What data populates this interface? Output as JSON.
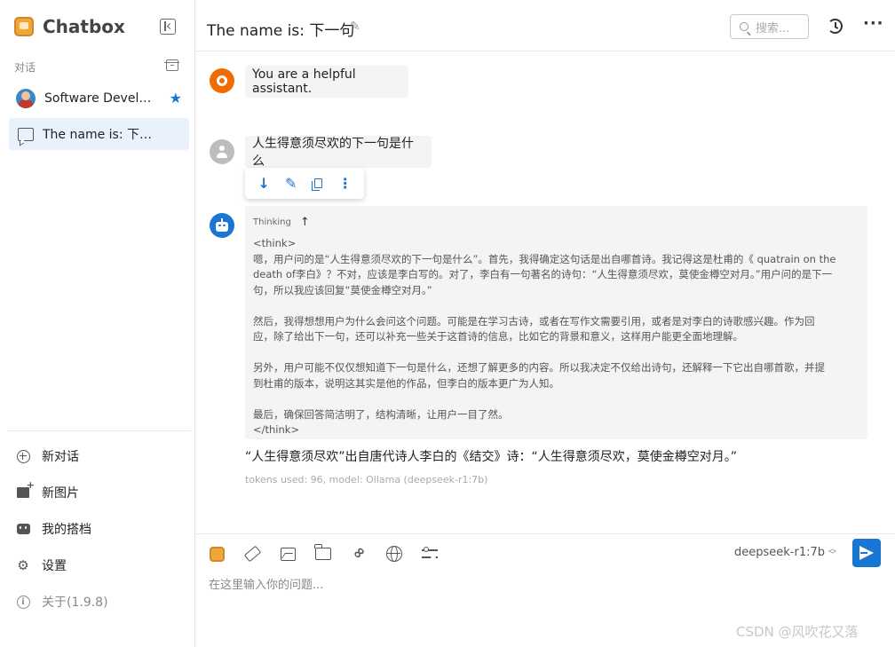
{
  "app": {
    "name": "Chatbox"
  },
  "sidebar": {
    "section_label": "对话",
    "conversations": [
      {
        "label": "Software Developer",
        "starred": true,
        "selected": false
      },
      {
        "label": "The name is: 下一句",
        "starred": false,
        "selected": true
      }
    ],
    "menu": [
      {
        "label": "新对话",
        "icon": "plus-circle-icon"
      },
      {
        "label": "新图片",
        "icon": "add-image-icon"
      },
      {
        "label": "我的搭档",
        "icon": "robot-icon"
      },
      {
        "label": "设置",
        "icon": "gear-icon"
      },
      {
        "label": "关于(1.9.8)",
        "icon": "info-icon"
      }
    ]
  },
  "header": {
    "title": "The name is: 下一句",
    "search_placeholder": "搜索..."
  },
  "messages": {
    "system": "You are a helpful assistant.",
    "user": "人生得意须尽欢的下一句是什么",
    "thinking_label": "Thinking",
    "thinking_lines": [
      "<think>",
      "嗯，用户问的是“人生得意须尽欢的下一句是什么”。首先，我得确定这句话是出自哪首诗。我记得这是杜甫的《 quatrain on the",
      "death of李白》？不对，应该是李白写的。对了，李白有一句著名的诗句：“人生得意须尽欢，莫使金樽空对月。”用户问的是下一",
      "句，所以我应该回复“莫使金樽空对月。”",
      "",
      "然后，我得想想用户为什么会问这个问题。可能是在学习古诗，或者在写作文需要引用，或者是对李白的诗歌感兴趣。作为回",
      "应，除了给出下一句，还可以补充一些关于这首诗的信息，比如它的背景和意义，这样用户能更全面地理解。",
      "",
      "另外，用户可能不仅仅想知道下一句是什么，还想了解更多的内容。所以我决定不仅给出诗句，还解释一下它出自哪首歌，并提",
      "到杜甫的版本，说明这其实是他的作品，但李白的版本更广为人知。",
      "",
      "最后，确保回答简洁明了，结构清晰，让用户一目了然。",
      "</think>"
    ],
    "answer": "“人生得意须尽欢”出自唐代诗人李白的《结交》诗：“人生得意须尽欢，莫使金樽空对月。”",
    "meta": "tokens used: 96, model: Ollama (deepseek-r1:7b)"
  },
  "input": {
    "model": "deepseek-r1:7b",
    "placeholder": "在这里输入你的问题..."
  },
  "watermark": "CSDN @风吹花又落",
  "colors": {
    "accent": "#1976d2",
    "system_avatar": "#ef6c00",
    "selected_bg": "#e8f1fc"
  }
}
